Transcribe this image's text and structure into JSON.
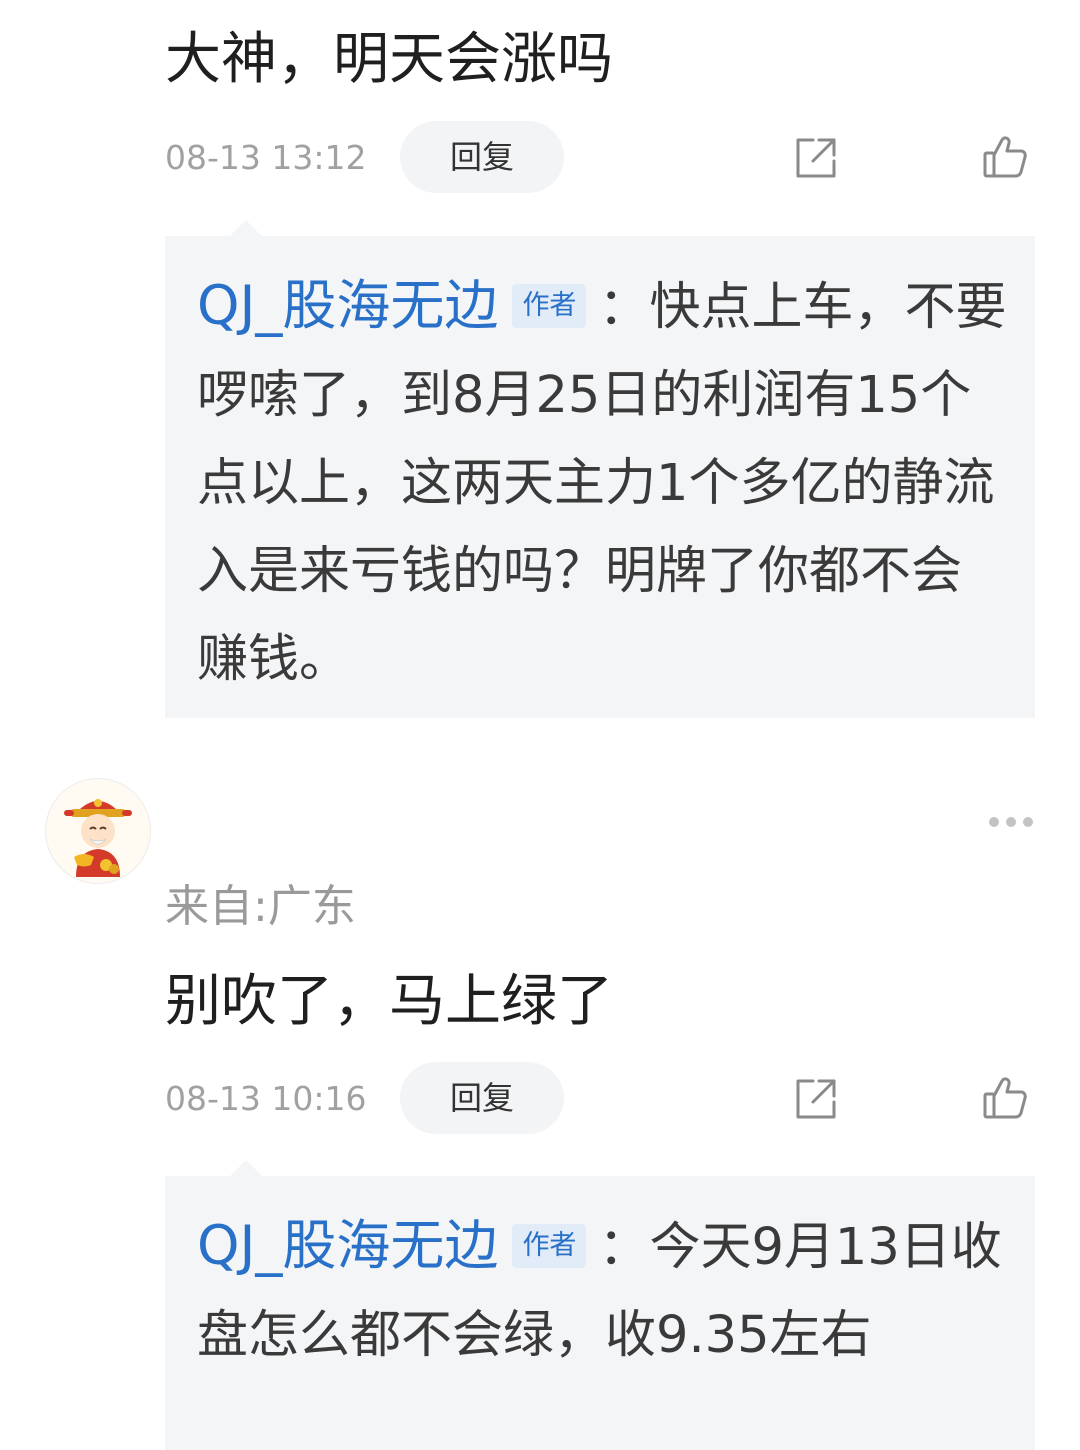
{
  "comments": [
    {
      "text": "大神，明天会涨吗",
      "timestamp": "08-13 13:12",
      "reply_label": "回复",
      "reply": {
        "author": "QJ_股海无边",
        "badge": "作者",
        "separator": "：",
        "text": "快点上车，不要啰嗦了，到8月25日的利润有15个点以上，这两天主力1个多亿的静流入是来亏钱的吗？明牌了你都不会赚钱。"
      }
    },
    {
      "location": "来自:广东",
      "text": "别吹了，马上绿了",
      "timestamp": "08-13 10:16",
      "reply_label": "回复",
      "reply": {
        "author": "QJ_股海无边",
        "badge": "作者",
        "separator": "：",
        "text": "今天9月13日收盘怎么都不会绿，收9.35左右"
      }
    }
  ],
  "icons": {
    "share": "share-icon",
    "like": "thumbs-up-icon",
    "more": "more-icon",
    "avatar": "fortune-god-avatar"
  },
  "colors": {
    "author_blue": "#2870c8",
    "reply_bg": "#f4f5f7",
    "timestamp_gray": "#a1a1a1"
  }
}
